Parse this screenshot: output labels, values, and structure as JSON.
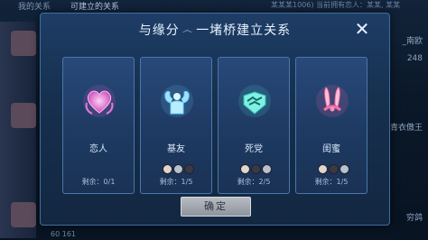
{
  "background": {
    "tabs": [
      "我的关系",
      "可建立的关系"
    ],
    "note": "某某某1006) 当前拥有恋人：某某, 某某",
    "right_rows": [
      {
        "name": "_南欧"
      },
      {
        "name": "248"
      },
      {
        "name": "青衣傲王"
      },
      {
        "name": "穷鸽"
      }
    ],
    "bottom_left": "60 161"
  },
  "modal": {
    "title_left": "与缘分",
    "title_right": "一堵桥建立关系",
    "close_label": "✕",
    "confirm_label": "确定"
  },
  "cards": [
    {
      "label": "恋人",
      "remaining": "剩余：0/1",
      "icon": "heart-icon",
      "color": "#e46ad6"
    },
    {
      "label": "基友",
      "remaining": "剩余：1/5",
      "icon": "flex-arms-icon",
      "color": "#6fd2ff"
    },
    {
      "label": "死党",
      "remaining": "剩余：2/5",
      "icon": "handshake-icon",
      "color": "#51e0d0"
    },
    {
      "label": "闺蜜",
      "remaining": "剩余：1/5",
      "icon": "bunny-ears-icon",
      "color": "#ff6ea8"
    }
  ]
}
